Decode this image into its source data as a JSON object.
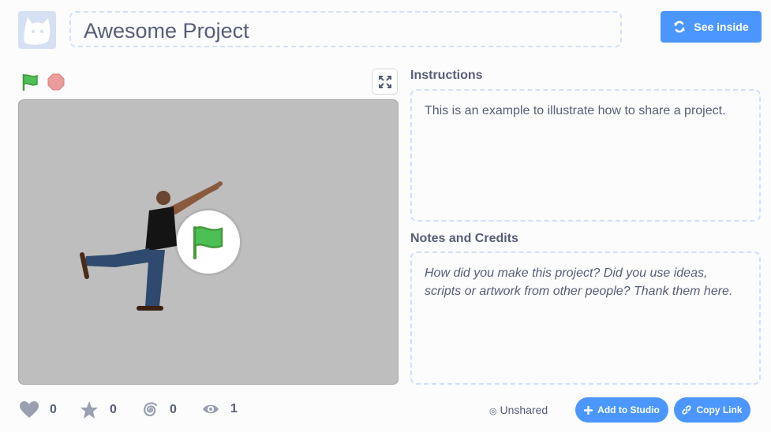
{
  "header": {
    "title": "Awesome Project",
    "see_inside_label": "See inside"
  },
  "sections": {
    "instructions_label": "Instructions",
    "instructions_text": "This is an example to illustrate how to share a project.",
    "notes_label": "Notes and Credits",
    "notes_placeholder": "How did you make this project? Did you use ideas, scripts or artwork from other people? Thank them here."
  },
  "stats": {
    "loves": "0",
    "favorites": "0",
    "remixes": "0",
    "views": "1"
  },
  "footer": {
    "share_status": "Unshared",
    "add_to_studio_label": "Add to Studio",
    "copy_link_label": "Copy Link"
  },
  "colors": {
    "accent": "#4c97ff",
    "green_flag": "#45993d",
    "stop": "#ec9c9c",
    "stage_bg": "#bebebe"
  },
  "icons": [
    "cat-avatar-icon",
    "remix-icon",
    "green-flag-icon",
    "stop-icon",
    "fullscreen-icon",
    "heart-icon",
    "star-icon",
    "remix-spiral-icon",
    "eye-icon",
    "plus-icon",
    "link-icon",
    "unshared-icon"
  ]
}
